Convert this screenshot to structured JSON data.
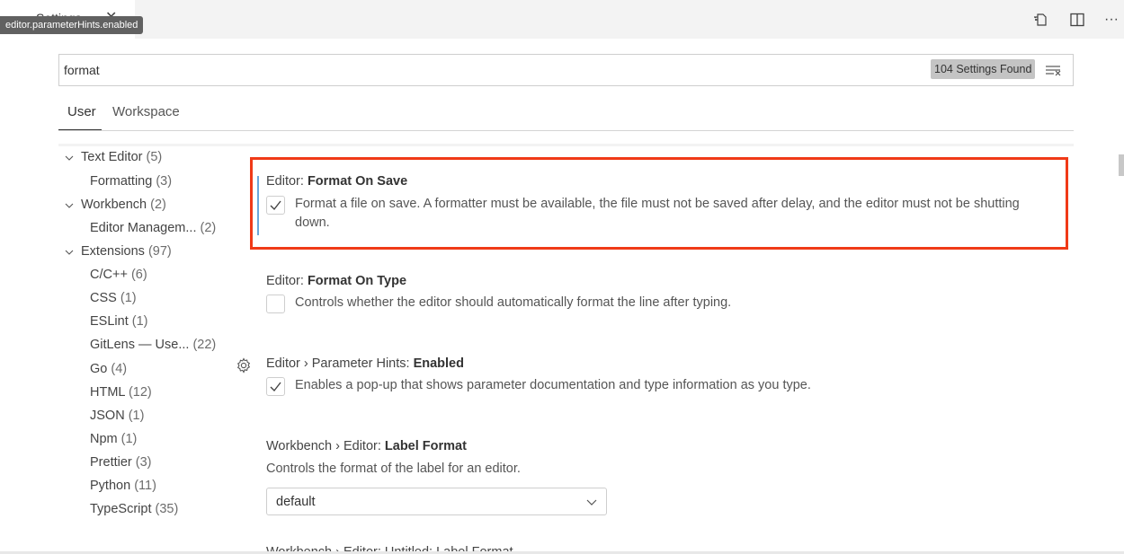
{
  "tab": {
    "title": "Settings",
    "tooltip": "editor.parameterHints.enabled"
  },
  "toolbar": {
    "icons": [
      "open-settings-json-icon",
      "split-editor-icon",
      "more-actions-icon"
    ],
    "more": "···"
  },
  "search": {
    "value": "format",
    "results_badge": "104 Settings Found"
  },
  "scope_tabs": [
    "User",
    "Workspace"
  ],
  "toc": [
    {
      "label": "Text Editor",
      "count": "(5)",
      "expanded": true
    },
    {
      "label": "Formatting",
      "count": "(3)"
    },
    {
      "label": "Workbench",
      "count": "(2)",
      "expanded": true
    },
    {
      "label": "Editor Managem...",
      "count": "(2)"
    },
    {
      "label": "Extensions",
      "count": "(97)",
      "expanded": true
    },
    {
      "label": "C/C++",
      "count": "(6)"
    },
    {
      "label": "CSS",
      "count": "(1)"
    },
    {
      "label": "ESLint",
      "count": "(1)"
    },
    {
      "label": "GitLens — Use...",
      "count": "(22)"
    },
    {
      "label": "Go",
      "count": "(4)"
    },
    {
      "label": "HTML",
      "count": "(12)"
    },
    {
      "label": "JSON",
      "count": "(1)"
    },
    {
      "label": "Npm",
      "count": "(1)"
    },
    {
      "label": "Prettier",
      "count": "(3)"
    },
    {
      "label": "Python",
      "count": "(11)"
    },
    {
      "label": "TypeScript",
      "count": "(35)"
    }
  ],
  "settings": [
    {
      "category": "Editor: ",
      "name": "Format On Save",
      "checked": true,
      "desc_line1": "Format a file on save. A formatter must be available, the file must not be saved after delay, and the editor must not be shutting",
      "desc_line2": "down."
    },
    {
      "category": "Editor: ",
      "name": "Format On Type",
      "checked": false,
      "desc": "Controls whether the editor should automatically format the line after typing."
    },
    {
      "category": "Editor › Parameter Hints: ",
      "name": "Enabled",
      "checked": true,
      "desc": "Enables a pop-up that shows parameter documentation and type information as you type."
    },
    {
      "category": "Workbench › Editor: ",
      "name": "Label Format",
      "desc": "Controls the format of the label for an editor.",
      "value": "default"
    },
    {
      "cutoff_text": "Workbench › Editor: Untitled: Label Format"
    }
  ],
  "colors": {
    "highlight_border": "#f03a17",
    "focus_bar": "#6aa6d9",
    "badge_bg": "#c4c4c4"
  }
}
